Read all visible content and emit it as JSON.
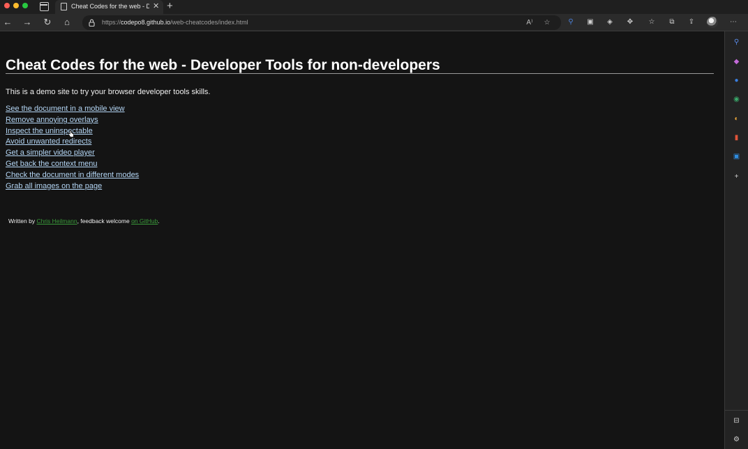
{
  "browser": {
    "tab": {
      "title": "Cheat Codes for the web - Developer Tools for non-developers"
    },
    "url": {
      "scheme": "https://",
      "host": "codepo8.github.io",
      "path": "/web-cheatcodes/index.html"
    }
  },
  "page": {
    "heading": "Cheat Codes for the web - Developer Tools for non-developers",
    "intro": "This is a demo site to try your browser developer tools skills.",
    "links": [
      "See the document in a mobile view",
      "Remove annoying overlays",
      "Inspect the uninspectable",
      "Avoid unwanted redirects",
      "Get a simpler video player",
      "Get back the context menu",
      "Check the document in different modes",
      "Grab all images on the page"
    ],
    "footer": {
      "prefix": "Written by ",
      "author": "Chris Heilmann",
      "middle": ", feedback welcome ",
      "github": "on GitHub",
      "suffix": "."
    }
  },
  "colors": {
    "background": "#141414",
    "link": "#b4d6f5",
    "footer_link": "#3a9a3a",
    "chrome": "#2b2b2b"
  }
}
